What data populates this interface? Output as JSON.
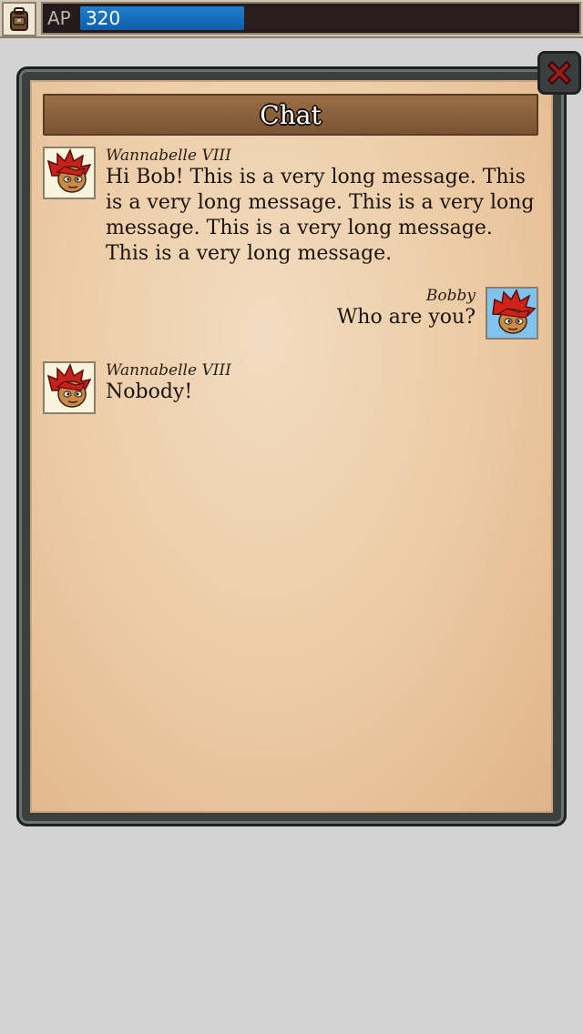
{
  "top_bar": {
    "ap_label": "AP",
    "ap_value": "320",
    "ap_fill_fraction": 0.33,
    "inventory_icon": "backpack-icon"
  },
  "chat": {
    "title": "Chat",
    "close_icon": "close-icon",
    "messages": [
      {
        "sender": "Wannabelle VIII",
        "text": "Hi Bob! This is a very long message. This is a very long message. This is a very long message. This is a very long message. This is a very long message.",
        "side": "left",
        "avatar": "red-haired-character-avatar"
      },
      {
        "sender": "Bobby",
        "text": "Who are you?",
        "side": "right",
        "avatar": "red-haired-character-avatar"
      },
      {
        "sender": "Wannabelle VIII",
        "text": "Nobody!",
        "side": "left",
        "avatar": "red-haired-character-avatar"
      }
    ]
  },
  "colors": {
    "ap_bar": "#1673c4",
    "header": "#8a6040",
    "parchment": "#eccca6"
  }
}
